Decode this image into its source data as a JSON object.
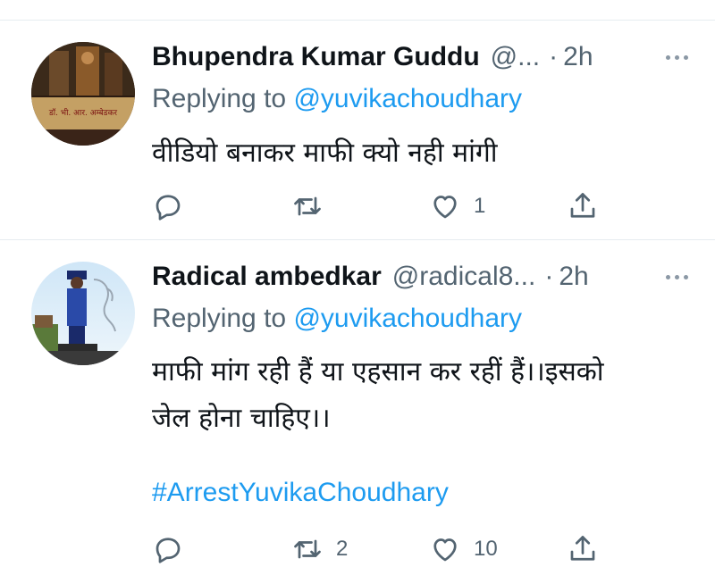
{
  "tweets": [
    {
      "name": "Bhupendra Kumar Guddu",
      "handle": "@...",
      "dot": "·",
      "time": "2h",
      "replying_prefix": "Replying to ",
      "replying_mention": "@yuvikachoudhary",
      "text": "वीडियो बनाकर माफी क्यो नही मांगी",
      "avatar_icon": "statue-banner-avatar",
      "avatar_caption": "डॉ. भी. आर. अम्बेडकर",
      "actions": {
        "reply_count": "",
        "retweet_count": "",
        "like_count": "1"
      }
    },
    {
      "name": "Radical ambedkar",
      "handle": "@radical8...",
      "dot": "·",
      "time": "2h",
      "replying_prefix": "Replying to ",
      "replying_mention": "@yuvikachoudhary",
      "text_line1": "माफी मांग रही हैं या एहसान कर रहीं हैं।।इसको",
      "text_line2": "जेल होना चाहिए।।",
      "hashtag": "#ArrestYuvikaChoudhary",
      "avatar_icon": "ambedkar-statue-avatar",
      "actions": {
        "reply_count": "",
        "retweet_count": "2",
        "like_count": "10"
      }
    }
  ],
  "colors": {
    "link": "#1d9bf0",
    "muted": "#536471",
    "divider": "#e6ecf0",
    "icon": "#536471"
  }
}
